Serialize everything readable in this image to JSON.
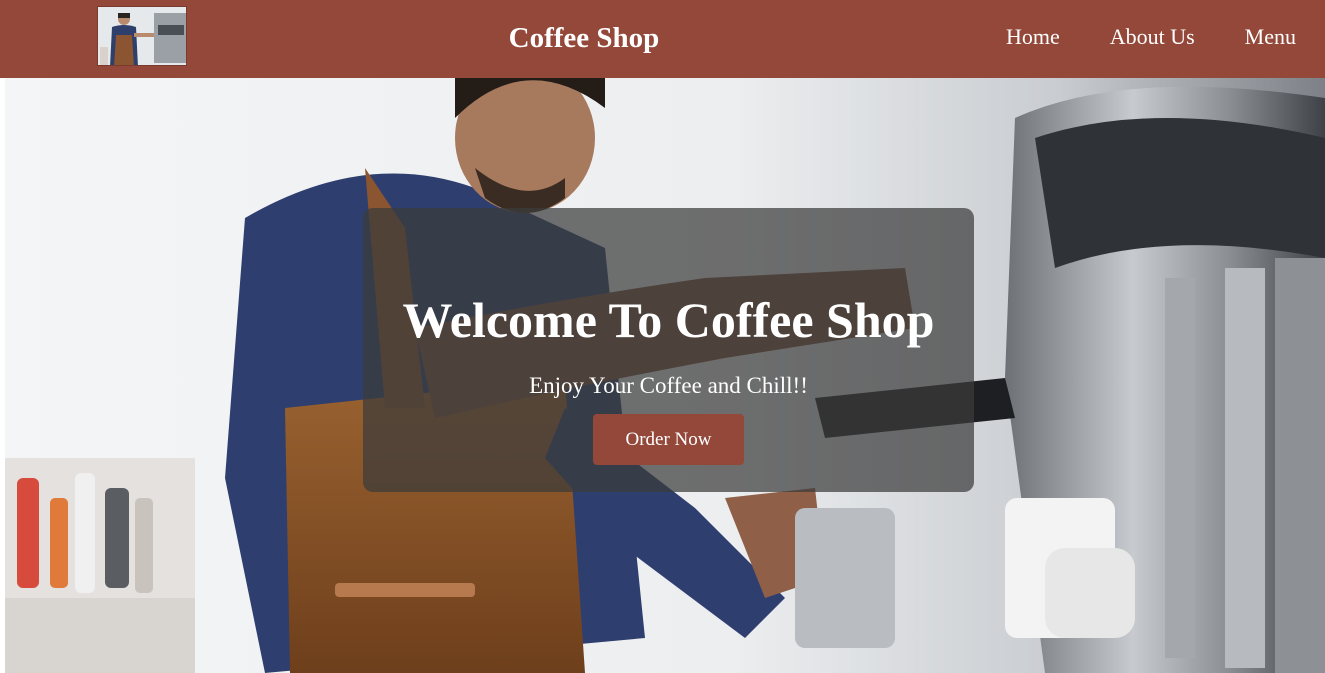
{
  "navbar": {
    "title": "Coffee Shop",
    "links": [
      "Home",
      "About Us",
      "Menu"
    ]
  },
  "hero": {
    "heading": "Welcome To Coffee Shop",
    "tagline": "Enjoy Your Coffee and Chill!!",
    "button_label": "Order Now"
  },
  "colors": {
    "brand": "#93483a",
    "overlay": "#3c3c3c",
    "text": "#ffffff"
  }
}
